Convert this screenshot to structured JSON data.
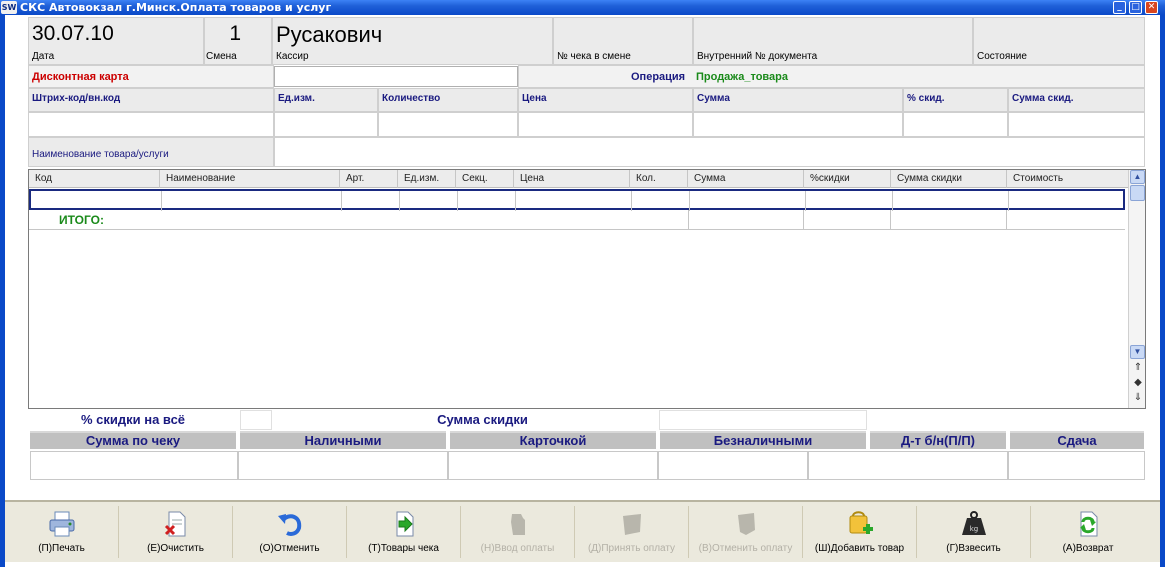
{
  "window": {
    "title": "СКС Автовокзал г.Минск.Оплата товаров и услуг",
    "app_icon_text": "SW"
  },
  "header": {
    "date_value": "30.07.10",
    "date_label": "Дата",
    "shift_value": "1",
    "shift_label": "Смена",
    "cashier_value": "Русакович",
    "cashier_label": "Кассир",
    "check_no_label": "№ чека в смене",
    "doc_no_label": "Внутренний № документа",
    "state_label": "Состояние"
  },
  "discount": {
    "label": "Дисконтная карта",
    "value": "",
    "operation_label": "Операция",
    "operation_value": "Продажа_товара"
  },
  "entry": {
    "headers": [
      "Штрих-код/вн.код",
      "Ед.изм.",
      "Количество",
      "Цена",
      "Сумма",
      "% скид.",
      "Сумма скид."
    ],
    "name_label": "Наименование товара/услуги"
  },
  "grid": {
    "columns": [
      "Код",
      "Наименование",
      "Арт.",
      "Ед.изм.",
      "Секц.",
      "Цена",
      "Кол.",
      "Сумма",
      "%скидки",
      "Сумма скидки",
      "Стоимость"
    ],
    "total_label": "ИТОГО:"
  },
  "totals": {
    "discount_all_label": "% скидки на всё",
    "discount_sum_label": "Сумма скидки"
  },
  "payment": {
    "headers": [
      "Сумма по чеку",
      "Наличными",
      "Карточкой",
      "Безналичными",
      "Д-т б/н(П/П)",
      "Сдача"
    ]
  },
  "toolbar": {
    "buttons": [
      {
        "label": "(П)Печать",
        "icon": "printer-icon",
        "enabled": true
      },
      {
        "label": "(Е)Очистить",
        "icon": "clear-document-icon",
        "enabled": true
      },
      {
        "label": "(О)Отменить",
        "icon": "undo-arrow-icon",
        "enabled": true
      },
      {
        "label": "(Т)Товары чека",
        "icon": "check-items-icon",
        "enabled": true
      },
      {
        "label": "(Н)Ввод оплаты",
        "icon": "payment-entry-icon",
        "enabled": false
      },
      {
        "label": "(Д)Принять оплату",
        "icon": "accept-payment-icon",
        "enabled": false
      },
      {
        "label": "(В)Отменить оплату",
        "icon": "cancel-payment-icon",
        "enabled": false
      },
      {
        "label": "(Ш)Добавить товар",
        "icon": "add-product-icon",
        "enabled": true
      },
      {
        "label": "(Г)Взвесить",
        "icon": "weight-icon",
        "enabled": true
      },
      {
        "label": "(А)Возврат",
        "icon": "return-icon",
        "enabled": true
      }
    ]
  },
  "colors": {
    "title_blue": "#0a49c8",
    "label_navy": "#1a1a80",
    "discount_red": "#cc0000",
    "operation_green": "#1a8a1a",
    "total_green": "#1a8a1a"
  }
}
